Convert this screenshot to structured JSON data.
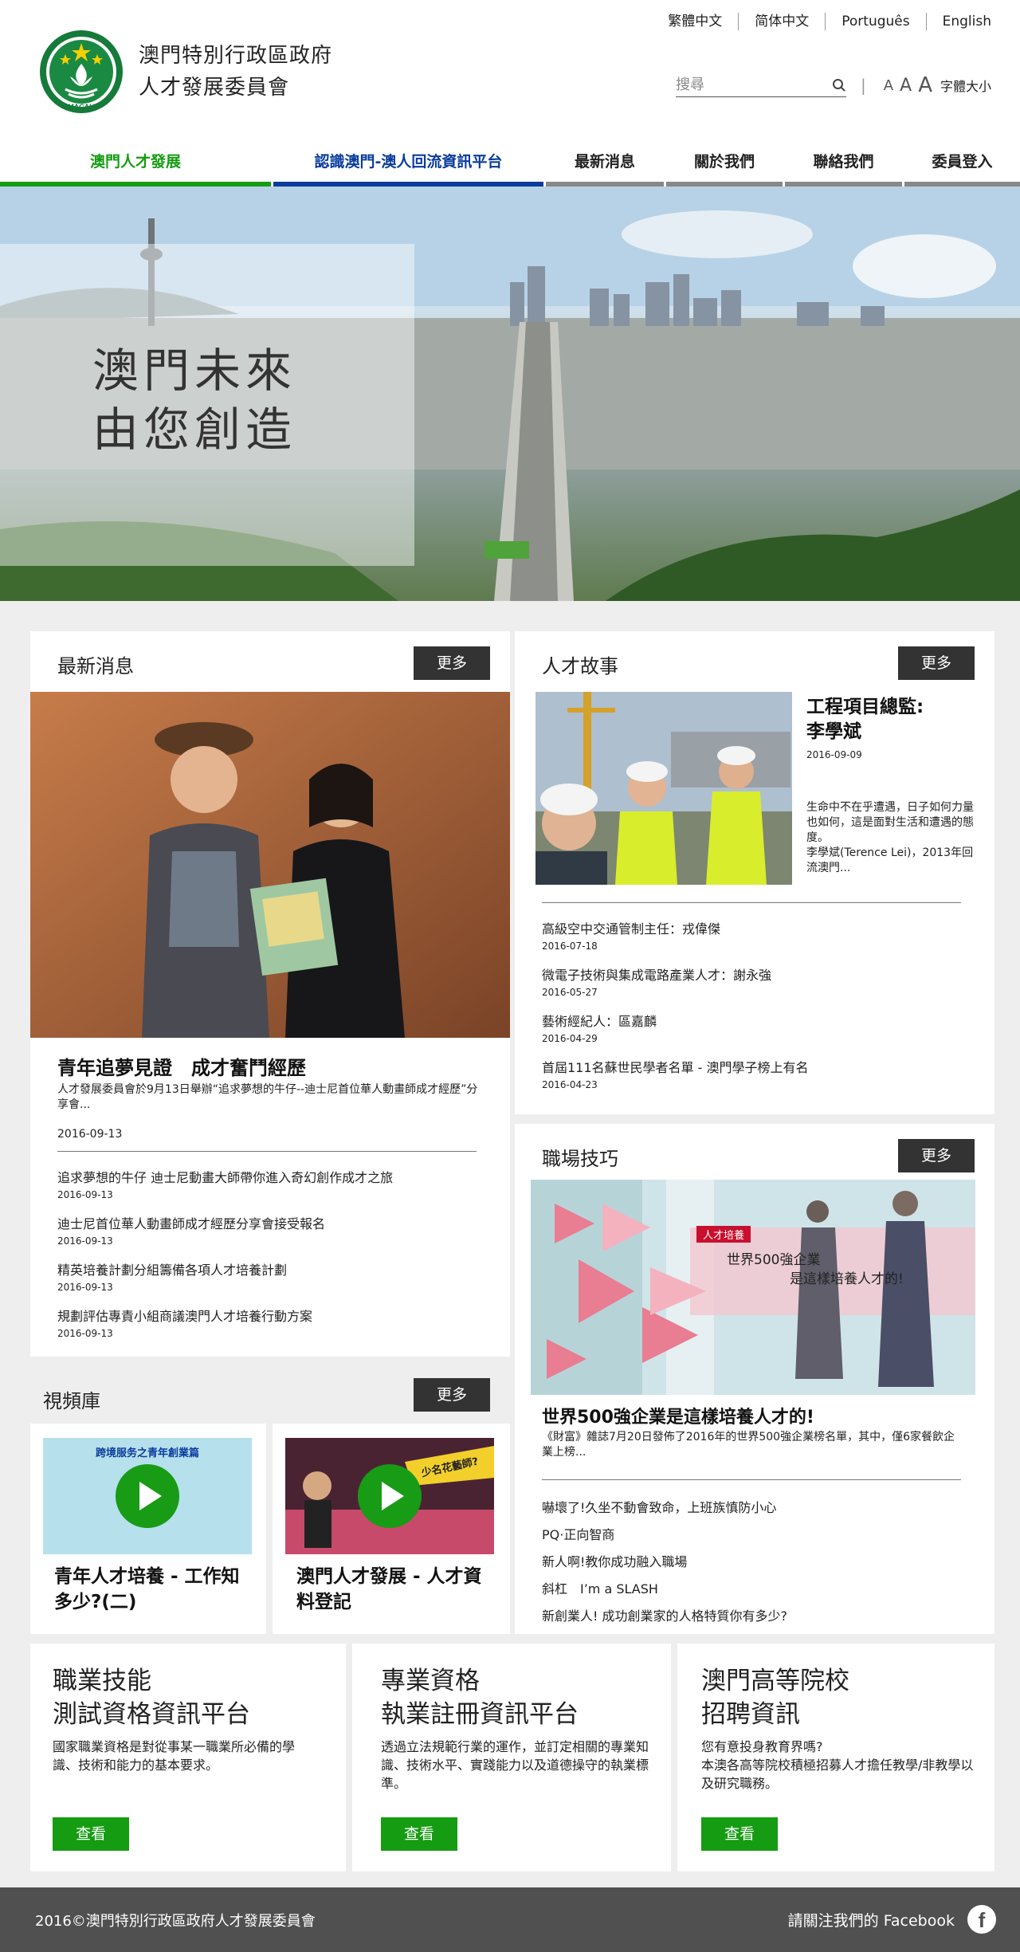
{
  "header": {
    "org_line1": "澳門特別行政區政府",
    "org_line2": "人才發展委員會",
    "emblem_text": "MACAU",
    "languages": [
      "繁體中文",
      "简体中文",
      "Português",
      "English"
    ],
    "search_placeholder": "搜尋",
    "font_small": "A",
    "font_medium": "A",
    "font_large": "A",
    "font_size_label": "字體大小"
  },
  "nav": {
    "items": [
      "澳門人才發展",
      "認識澳門-澳人回流資訊平台",
      "最新消息",
      "關於我們",
      "聯絡我們",
      "委員登入"
    ]
  },
  "hero": {
    "line1": "澳門未來",
    "line2": "由您創造"
  },
  "news": {
    "title": "最新消息",
    "more": "更多",
    "headline": "青年追夢見證　成才奮鬥經歷",
    "summary": "人才發展委員會於9月13日舉辦“追求夢想的牛仔--迪士尼首位華人動畫師成才經歷”分享會...",
    "date": "2016-09-13",
    "items": [
      {
        "title": "追求夢想的牛仔 迪士尼動畫大師帶你進入奇幻創作成才之旅",
        "date": "2016-09-13"
      },
      {
        "title": "迪士尼首位華人動畫師成才經歷分享會接受報名",
        "date": "2016-09-13"
      },
      {
        "title": "精英培養計劃分組籌備各項人才培養計劃",
        "date": "2016-09-13"
      },
      {
        "title": "規劃評估專責小組商議澳門人才培養行動方案",
        "date": "2016-09-13"
      }
    ]
  },
  "stories": {
    "title": "人才故事",
    "more": "更多",
    "feature_title": "工程項目總監:\n李學斌",
    "feature_date": "2016-09-09",
    "feature_summary": "生命中不在乎遭遇，日子如何力量也如何，這是面對生活和遭遇的態度。\n李學斌(Terence Lei)，2013年回流澳門...",
    "items": [
      {
        "title": "高級空中交通管制主任：戎偉傑",
        "date": "2016-07-18"
      },
      {
        "title": "微電子技術與集成電路產業人才：謝永強",
        "date": "2016-05-27"
      },
      {
        "title": "藝術經紀人：區嘉麟",
        "date": "2016-04-29"
      },
      {
        "title": "首屆111名蘇世民學者名單 - 澳門學子榜上有名",
        "date": "2016-04-23"
      }
    ]
  },
  "tips": {
    "title": "職場技巧",
    "more": "更多",
    "image_tag": "人才培養",
    "image_caption1": "世界500強企業",
    "image_caption2": "是這樣培養人才的!",
    "headline": "世界500強企業是這樣培養人才的!",
    "summary": "《財富》雜誌7月20日發佈了2016年的世界500強企業榜名單，其中，僅6家餐飲企業上榜...",
    "items": [
      "嚇壞了!久坐不動會致命，上班族慎防小心",
      "PQ·正向智商",
      "新人啊!教你成功融入職場",
      "斜杠　I’m a SLASH",
      "新創業人! 成功創業家的人格特質你有多少?"
    ]
  },
  "videos": {
    "title": "視頻庫",
    "more": "更多",
    "items": [
      {
        "title": "青年人才培養 - 工作知多少?(二)",
        "thumb_text": "跨境服务之青年創業篇"
      },
      {
        "title": "澳門人才發展 - 人才資料登記",
        "thumb_text": "少名花藝師?"
      }
    ]
  },
  "platforms": [
    {
      "title1": "職業技能",
      "title2": "測試資格資訊平台",
      "desc": "國家職業資格是對從事某一職業所必備的學識、技術和能力的基本要求。",
      "button": "查看"
    },
    {
      "title1": "專業資格",
      "title2": "執業註冊資訊平台",
      "desc": "透過立法規範行業的運作，並訂定相關的專業知識、技術水平、實踐能力以及道德操守的執業標準。",
      "button": "查看"
    },
    {
      "title1": "澳門高等院校",
      "title2": "招聘資訊",
      "desc": "您有意投身教育界嗎?\n本澳各高等院校積極招募人才擔任教學/非教學以及研究職務。",
      "button": "查看"
    }
  ],
  "footer": {
    "copyright": "2016©澳門特別行政區政府人才發展委員會",
    "facebook_label": "請關注我們的 Facebook",
    "facebook_icon": "f"
  },
  "colors": {
    "green": "#169c13",
    "blue": "#0a3c9c",
    "dark": "#333333",
    "footer": "#505050"
  }
}
